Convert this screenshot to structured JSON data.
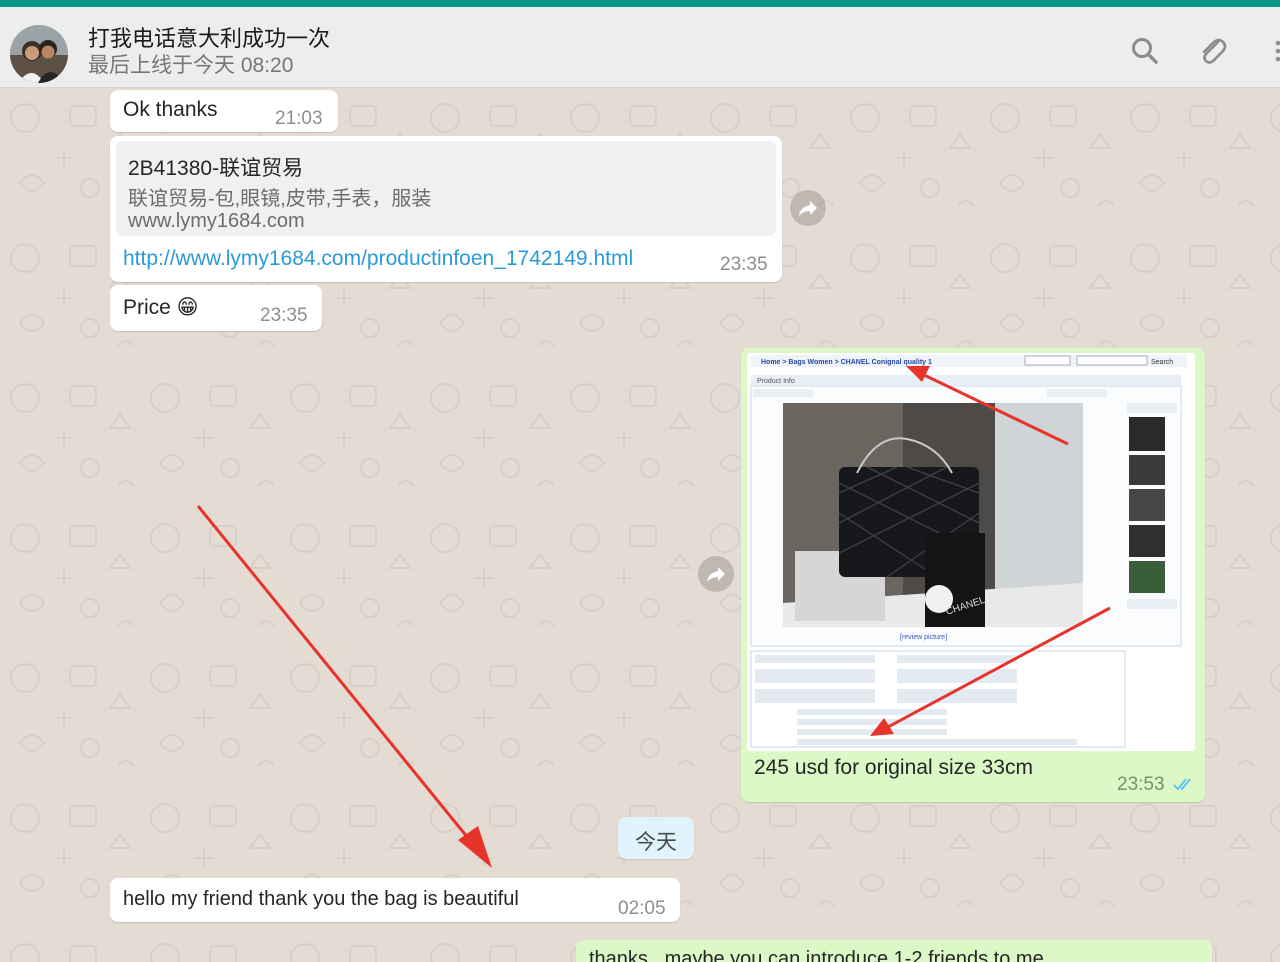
{
  "header": {
    "contact_name": "打我电话意大利成功一次",
    "contact_status": "最后上线于今天 08:20",
    "icons": [
      "search-icon",
      "attach-icon",
      "menu-icon"
    ]
  },
  "messages": {
    "m1": {
      "text": "Ok thanks",
      "time": "21:03"
    },
    "m2": {
      "preview_title": "2B41380-联谊贸易",
      "preview_desc": "联谊贸易-包,眼镜,皮带,手表，服装",
      "preview_site": "www.lymy1684.com",
      "link": "http://www.lymy1684.com/productinfoen_1742149.html",
      "time": "23:35"
    },
    "m3": {
      "text": "Price 😁",
      "time": "23:35"
    },
    "m4": {
      "caption": "245 usd for original size 33cm",
      "time": "23:53",
      "status_icon": "double-check-icon",
      "image": {
        "breadcrumb": "Home > Bags Women > CHANEL Conignal quality 1",
        "search_button": "Search",
        "section_title": "Product Info",
        "image_caption": "[review picture]",
        "brand_text": "CHANEL"
      }
    },
    "day_separator": "今天",
    "m5": {
      "text": "hello my friend thank you the bag is beautiful",
      "time": "02:05"
    },
    "m6": {
      "text": "thanks , maybe you can introduce 1-2 friends to me"
    }
  },
  "colors": {
    "accent": "#009688",
    "incoming_bubble": "#ffffff",
    "outgoing_bubble": "#dcf8c6",
    "link": "#2a9bd5",
    "annotation_arrow": "#e8332b",
    "read_check": "#4fc3f7"
  }
}
